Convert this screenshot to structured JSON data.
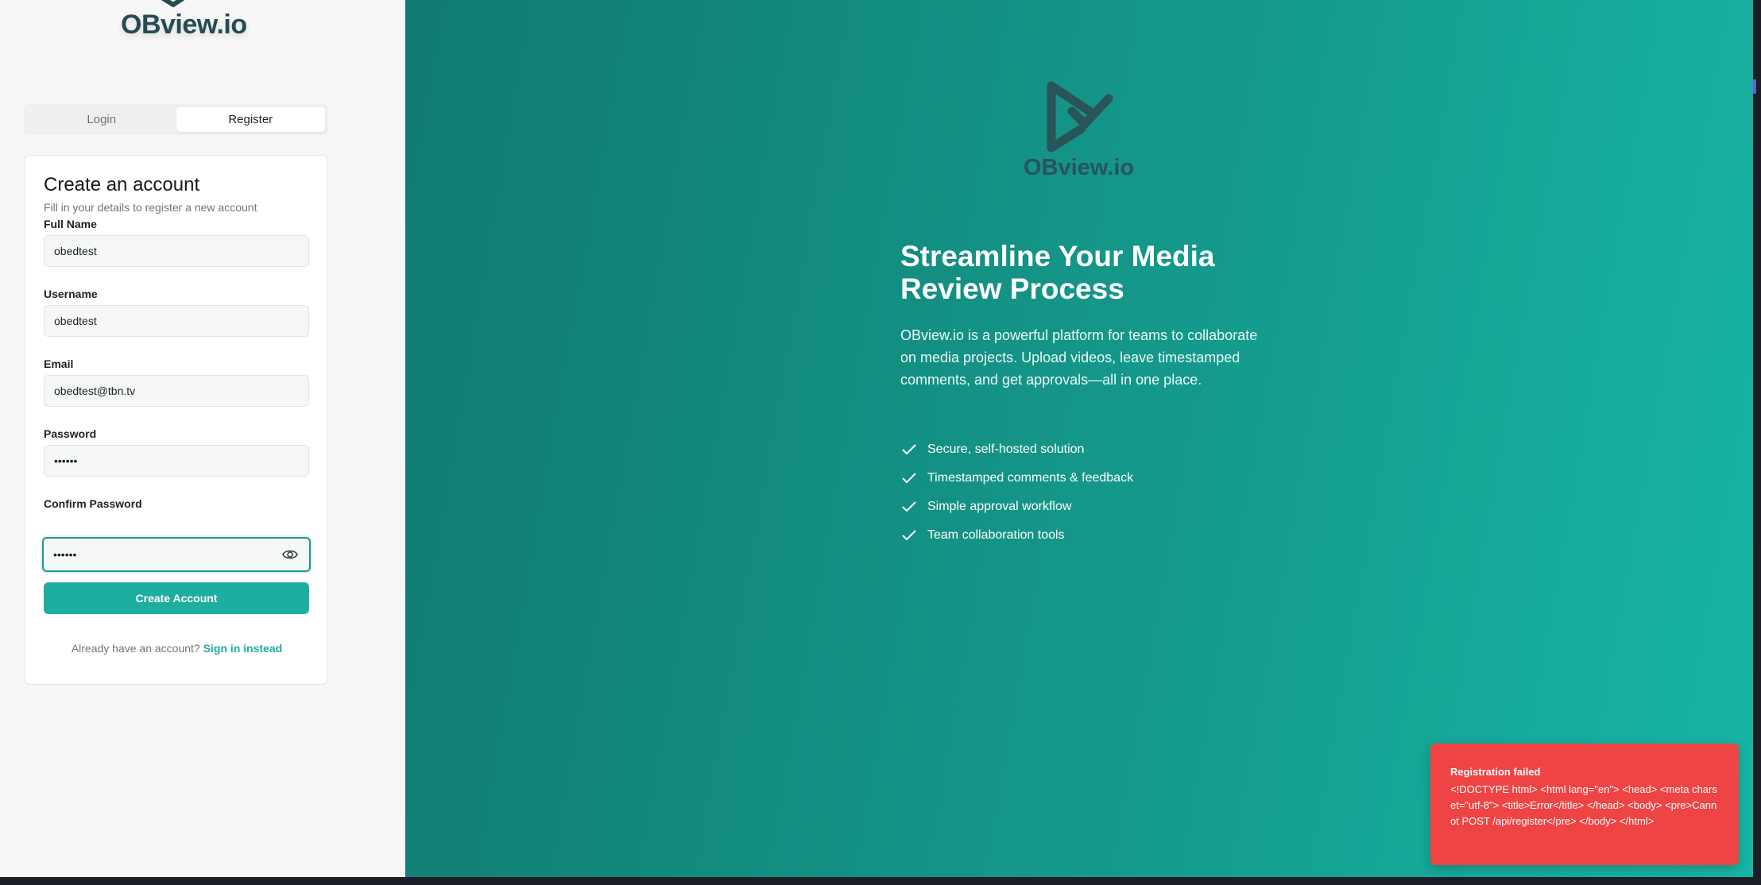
{
  "brand": {
    "name": "OBview.io"
  },
  "auth_tabs": [
    {
      "label": "Login",
      "active": false
    },
    {
      "label": "Register",
      "active": true
    }
  ],
  "form": {
    "title": "Create an account",
    "subtitle": "Fill in your details to register a new account",
    "fields": {
      "full_name": {
        "label": "Full Name",
        "value": "obedtest"
      },
      "username": {
        "label": "Username",
        "value": "obedtest"
      },
      "email": {
        "label": "Email",
        "value": "obedtest@tbn.tv"
      },
      "password": {
        "label": "Password",
        "value": "••••••"
      },
      "confirm_password": {
        "label": "Confirm Password",
        "value": "••••••"
      }
    },
    "submit_label": "Create Account",
    "signin_prompt": "Already have an account?",
    "signin_link": "Sign in instead"
  },
  "hero": {
    "headline": "Streamline Your Media Review Process",
    "description": "OBview.io is a powerful platform for teams to collaborate on media projects. Upload videos, leave timestamped comments, and get approvals—all in one place.",
    "features": [
      "Secure, self-hosted solution",
      "Timestamped comments & feedback",
      "Simple approval workflow",
      "Team collaboration tools"
    ]
  },
  "toast": {
    "title": "Registration failed",
    "message": "<!DOCTYPE html> <html lang=\"en\"> <head> <meta charset=\"utf-8\"> <title>Error</title> </head> <body> <pre>Cannot POST /api/register</pre> </body> </html>"
  },
  "colors": {
    "accent": "#1eaea0",
    "panel_gradient_start": "#117a70",
    "panel_gradient_end": "#17b5a4",
    "logo": "#274b52",
    "error": "#ef4444"
  },
  "icons": {
    "logo": "play-check-icon",
    "password_toggle": "eye-icon",
    "feature_bullet": "check-icon"
  }
}
